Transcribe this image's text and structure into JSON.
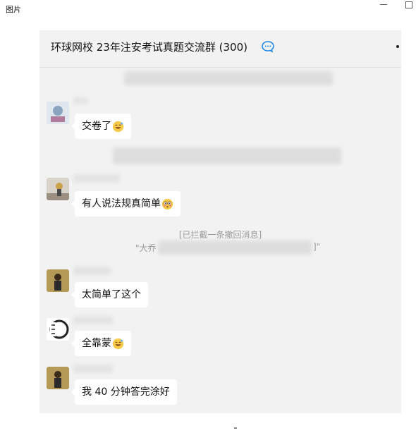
{
  "window": {
    "title": "图片"
  },
  "chat": {
    "group_name": "环球网校 23年注安考试真题交流群 (300)",
    "system_notice": "[已拦截一条撤回消息]",
    "quote_open": "\"大乔",
    "quote_close": "]\"",
    "messages": [
      {
        "text": "交卷了",
        "emoji": "grin-sweat-emoji"
      },
      {
        "text": "有人说法规真简单",
        "emoji": "flushed-emoji"
      },
      {
        "text": "太简单了这个",
        "emoji": ""
      },
      {
        "text": "全靠蒙",
        "emoji": "grin-sweat-emoji"
      },
      {
        "text": "我 40 分钟答完涂好",
        "emoji": ""
      }
    ]
  },
  "colors": {
    "chat_bg": "#f2f2f2",
    "bubble_bg": "#ffffff",
    "accent_blue": "#1e88e5"
  }
}
